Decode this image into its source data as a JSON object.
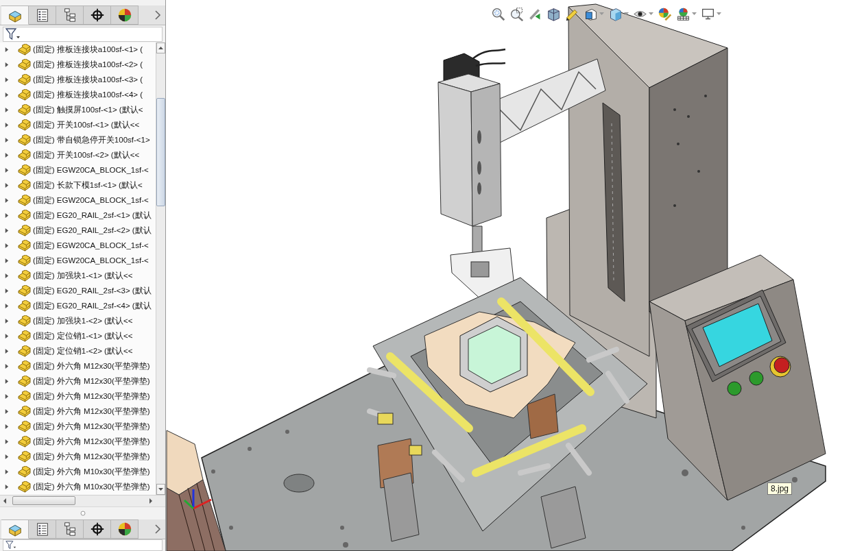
{
  "feature_manager": {
    "tabs": [
      {
        "kind": "feature-tree",
        "selected": true
      },
      {
        "kind": "property-list",
        "selected": false
      },
      {
        "kind": "configuration-tree",
        "selected": false
      },
      {
        "kind": "crosshair",
        "selected": false
      },
      {
        "kind": "appearance",
        "selected": false
      }
    ],
    "tree": [
      {
        "label": "(固定) 推板连接块a100sf-<1> (",
        "expanded": false
      },
      {
        "label": "(固定) 推板连接块a100sf-<2> (",
        "expanded": false
      },
      {
        "label": "(固定) 推板连接块a100sf-<3> (",
        "expanded": false
      },
      {
        "label": "(固定) 推板连接块a100sf-<4> (",
        "expanded": false
      },
      {
        "label": "(固定) 触摸屏100sf-<1> (默认<",
        "expanded": false
      },
      {
        "label": "(固定) 开关100sf-<1> (默认<<",
        "expanded": false
      },
      {
        "label": "(固定) 带自锁急停开关100sf-<1>",
        "expanded": false
      },
      {
        "label": "(固定) 开关100sf-<2> (默认<<",
        "expanded": false
      },
      {
        "label": "(固定) EGW20CA_BLOCK_1sf-<",
        "expanded": false
      },
      {
        "label": "(固定) 长款下模1sf-<1> (默认<",
        "expanded": false
      },
      {
        "label": "(固定) EGW20CA_BLOCK_1sf-<",
        "expanded": false
      },
      {
        "label": "(固定) EG20_RAIL_2sf-<1> (默认",
        "expanded": false
      },
      {
        "label": "(固定) EG20_RAIL_2sf-<2> (默认",
        "expanded": false
      },
      {
        "label": "(固定) EGW20CA_BLOCK_1sf-<",
        "expanded": false
      },
      {
        "label": "(固定) EGW20CA_BLOCK_1sf-<",
        "expanded": false
      },
      {
        "label": "(固定) 加强块1-<1> (默认<<",
        "expanded": false
      },
      {
        "label": "(固定) EG20_RAIL_2sf-<3> (默认",
        "expanded": false
      },
      {
        "label": "(固定) EG20_RAIL_2sf-<4> (默认",
        "expanded": false
      },
      {
        "label": "(固定) 加强块1-<2> (默认<<",
        "expanded": false
      },
      {
        "label": "(固定) 定位销1-<1> (默认<<",
        "expanded": false
      },
      {
        "label": "(固定) 定位销1-<2> (默认<<",
        "expanded": false
      },
      {
        "label": "(固定) 外六角 M12x30(平垫弹垫)",
        "expanded": false
      },
      {
        "label": "(固定) 外六角 M12x30(平垫弹垫)",
        "expanded": false
      },
      {
        "label": "(固定) 外六角 M12x30(平垫弹垫)",
        "expanded": false
      },
      {
        "label": "(固定) 外六角 M12x30(平垫弹垫)",
        "expanded": false
      },
      {
        "label": "(固定) 外六角 M12x30(平垫弹垫)",
        "expanded": false
      },
      {
        "label": "(固定) 外六角 M12x30(平垫弹垫)",
        "expanded": false
      },
      {
        "label": "(固定) 外六角 M12x30(平垫弹垫)",
        "expanded": false
      },
      {
        "label": "(固定) 外六角 M10x30(平垫弹垫)",
        "expanded": false
      },
      {
        "label": "(固定) 外六角 M10x30(平垫弹垫)",
        "expanded": false
      }
    ],
    "lower_tabs": [
      {
        "kind": "feature-tree",
        "selected": true
      },
      {
        "kind": "property-list",
        "selected": false
      },
      {
        "kind": "configuration-tree",
        "selected": false
      },
      {
        "kind": "crosshair",
        "selected": false
      },
      {
        "kind": "appearance",
        "selected": false
      }
    ]
  },
  "view_toolbar": [
    {
      "kind": "zoom-fit",
      "dropdown": false
    },
    {
      "kind": "zoom-area",
      "dropdown": false
    },
    {
      "kind": "previous-view",
      "dropdown": false
    },
    {
      "kind": "section-view",
      "dropdown": false
    },
    {
      "kind": "annotation-view",
      "dropdown": false
    },
    {
      "kind": "view-cube",
      "dropdown": true
    },
    {
      "kind": "display-style",
      "dropdown": true
    },
    {
      "kind": "eye",
      "dropdown": true
    },
    {
      "kind": "appearance-pencil",
      "dropdown": false
    },
    {
      "kind": "scene",
      "dropdown": true
    },
    {
      "kind": "monitor",
      "dropdown": true
    }
  ],
  "tooltip": {
    "text": "8.jpg"
  }
}
